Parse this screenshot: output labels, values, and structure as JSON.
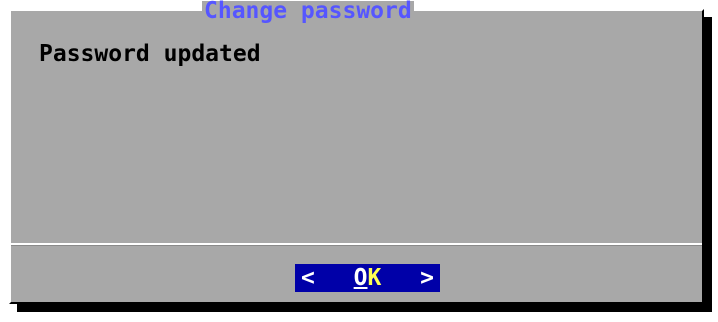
{
  "dialog": {
    "title": "Change password",
    "message": "Password updated"
  },
  "buttons": {
    "ok": {
      "left_bracket": "<",
      "hotkey": "O",
      "rest": "K",
      "right_bracket": ">"
    }
  },
  "colors": {
    "dialog_background": "#a8a8a8",
    "title_text": "#5656ff",
    "button_background": "#0000a8",
    "button_accent": "#ffff54"
  }
}
